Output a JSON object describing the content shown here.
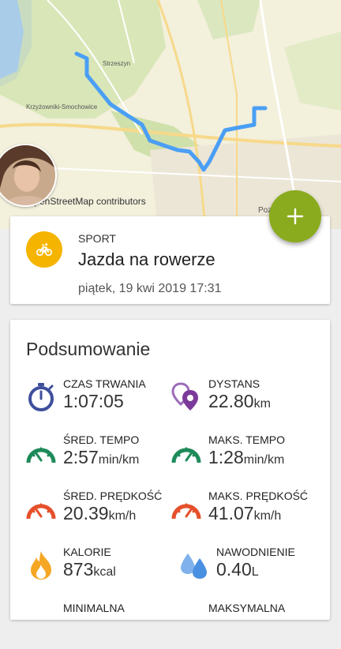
{
  "map": {
    "attribution": "OpenStreetMap contributors",
    "labels": {
      "strzeszyn": "Strzeszyn",
      "krzyzowniki": "Krzyżowniki-Smochowice",
      "poznan": "Poz"
    }
  },
  "fab": {
    "icon": "plus-icon"
  },
  "activity": {
    "sport_label": "SPORT",
    "sport_name": "Jazda na rowerze",
    "date": "piątek, 19 kwi 2019 17:31",
    "icon": "bicycle-icon"
  },
  "summary": {
    "title": "Podsumowanie",
    "stats": [
      {
        "label": "CZAS TRWANIA",
        "value": "1:07:05",
        "unit": "",
        "icon": "stopwatch-icon"
      },
      {
        "label": "DYSTANS",
        "value": "22.80",
        "unit": "km",
        "icon": "map-pins-icon"
      },
      {
        "label": "ŚRED. TEMPO",
        "value": "2:57",
        "unit": "min/km",
        "icon": "pace-gauge-icon"
      },
      {
        "label": "MAKS. TEMPO",
        "value": "1:28",
        "unit": "min/km",
        "icon": "pace-gauge-icon"
      },
      {
        "label": "ŚRED. PRĘDKOŚĆ",
        "value": "20.39",
        "unit": "km/h",
        "icon": "speed-gauge-icon"
      },
      {
        "label": "MAKS. PRĘDKOŚĆ",
        "value": "41.07",
        "unit": "km/h",
        "icon": "speed-gauge-icon"
      },
      {
        "label": "KALORIE",
        "value": "873",
        "unit": "kcal",
        "icon": "flame-icon"
      },
      {
        "label": "NAWODNIENIE",
        "value": "0.40",
        "unit": "L",
        "icon": "water-drops-icon"
      },
      {
        "label": "MINIMALNA",
        "value": "",
        "unit": "",
        "icon": ""
      },
      {
        "label": "MAKSYMALNA",
        "value": "",
        "unit": "",
        "icon": ""
      }
    ]
  },
  "colors": {
    "fab": "#8aab1d",
    "sport_icon_bg": "#f5b400",
    "route": "#4a9ff5",
    "stopwatch": "#3e4f9c",
    "distance": "#7b3a9a",
    "pace": "#1e8a5a",
    "speed": "#e5502a",
    "flame": "#f5a623",
    "water": "#4a90e2"
  }
}
